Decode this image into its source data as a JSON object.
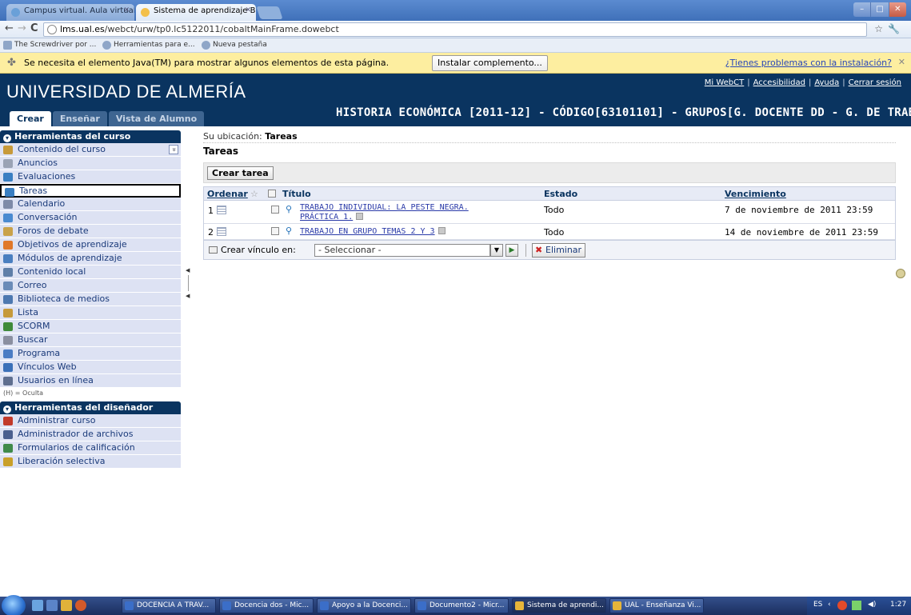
{
  "browser": {
    "tabs": [
      {
        "label": "Campus virtual. Aula virtual",
        "active": false
      },
      {
        "label": "Sistema de aprendizaje Blac",
        "active": true
      }
    ],
    "url_host": "lms.ual.es",
    "url_path": "/webct/urw/tp0.lc5122011/cobaltMainFrame.dowebct",
    "bookmarks": [
      "The Screwdriver por ...",
      "Herramientas para e...",
      "Nueva pestaña"
    ],
    "infobar": {
      "message": "Se necesita el elemento Java(TM) para mostrar algunos elementos de esta página.",
      "install_button": "Instalar complemento...",
      "help_link": "¿Tienes problemas con la instalación?"
    }
  },
  "header": {
    "university": "UNIVERSIDAD DE ALMERÍA",
    "links": [
      "Mi WebCT",
      "Accesibilidad",
      "Ayuda",
      "Cerrar sesión"
    ],
    "mode_tabs": [
      "Crear",
      "Enseñar",
      "Vista de Alumno"
    ],
    "course_title": "HISTORIA ECONÓMICA [2011-12] - CÓDIGO[63101101] - GRUPOS[G. DOCENTE DD - G. DE TRABAJO]"
  },
  "sidebar": {
    "course_tools_title": "Herramientas del curso",
    "course_tools": [
      {
        "label": "Contenido del curso",
        "icon": "course-content-icon",
        "color": "#c79a3a"
      },
      {
        "label": "Anuncios",
        "icon": "megaphone-icon",
        "color": "#9aa3b5"
      },
      {
        "label": "Evaluaciones",
        "icon": "assessment-icon",
        "color": "#3a7fc2"
      },
      {
        "label": "Tareas",
        "icon": "assignment-icon",
        "color": "#3a7fc2",
        "selected": true
      },
      {
        "label": "Calendario",
        "icon": "calendar-icon",
        "color": "#7d8aa8"
      },
      {
        "label": "Conversación",
        "icon": "chat-icon",
        "color": "#4a8ad0"
      },
      {
        "label": "Foros de debate",
        "icon": "discussion-icon",
        "color": "#c9a24a"
      },
      {
        "label": "Objetivos de aprendizaje",
        "icon": "objectives-icon",
        "color": "#e0782a"
      },
      {
        "label": "Módulos de aprendizaje",
        "icon": "modules-icon",
        "color": "#4a7fc0"
      },
      {
        "label": "Contenido local",
        "icon": "local-content-icon",
        "color": "#5f7fa8"
      },
      {
        "label": "Correo",
        "icon": "mail-icon",
        "color": "#6a8bb8"
      },
      {
        "label": "Biblioteca de medios",
        "icon": "media-library-icon",
        "color": "#4d78b0"
      },
      {
        "label": "Lista",
        "icon": "roster-icon",
        "color": "#c69a3a"
      },
      {
        "label": "SCORM",
        "icon": "scorm-icon",
        "color": "#3f8a3a"
      },
      {
        "label": "Buscar",
        "icon": "search-icon",
        "color": "#8a8fa0"
      },
      {
        "label": "Programa",
        "icon": "syllabus-icon",
        "color": "#4a7cc4"
      },
      {
        "label": "Vínculos Web",
        "icon": "web-links-icon",
        "color": "#3a70b8"
      },
      {
        "label": "Usuarios en línea",
        "icon": "online-users-icon",
        "color": "#5f6f8f"
      }
    ],
    "legend": "(H) = Oculta",
    "designer_tools_title": "Herramientas del diseñador",
    "designer_tools": [
      {
        "label": "Administrar curso",
        "icon": "manage-course-icon",
        "color": "#c23a2a"
      },
      {
        "label": "Administrador de archivos",
        "icon": "file-manager-icon",
        "color": "#4a5f8f"
      },
      {
        "label": "Formularios de calificación",
        "icon": "grade-forms-icon",
        "color": "#3f8a4a"
      },
      {
        "label": "Liberación selectiva",
        "icon": "selective-release-icon",
        "color": "#c9a02a"
      }
    ]
  },
  "main": {
    "breadcrumb_prefix": "Su ubicación:",
    "breadcrumb_current": "Tareas",
    "page_title": "Tareas",
    "create_button": "Crear tarea",
    "columns": {
      "order": "Ordenar",
      "title": "Título",
      "status": "Estado",
      "due": "Vencimiento"
    },
    "rows": [
      {
        "order": "1",
        "title": "TRABAJO INDIVIDUAL: LA PESTE NEGRA. PRÁCTICA 1.",
        "title_line1": "TRABAJO INDIVIDUAL: LA PESTE NEGRA.",
        "title_line2": "PRÁCTICA 1.",
        "status": "Todo",
        "due": "7 de noviembre de 2011 23:59"
      },
      {
        "order": "2",
        "title": "TRABAJO EN GRUPO TEMAS 2 Y 3",
        "status": "Todo",
        "due": "14 de noviembre de 2011 23:59"
      }
    ],
    "link_label": "Crear vínculo en:",
    "link_select_value": "- Seleccionar -",
    "delete_button": "Eliminar"
  },
  "taskbar": {
    "buttons": [
      "DOCENCIA A TRAV...",
      "Docencia dos - Mic...",
      "Apoyo a la Docenci...",
      "Documento2 - Micr...",
      "Sistema de aprendi...",
      "UAL - Enseñanza Vi..."
    ],
    "language": "ES",
    "clock": "1:27"
  }
}
